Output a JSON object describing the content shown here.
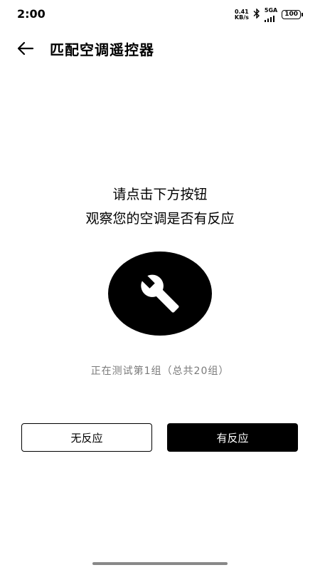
{
  "status_bar": {
    "time": "2:00",
    "net_speed_value": "0.41",
    "net_speed_unit": "KB/s",
    "bluetooth_icon": "bluetooth-icon",
    "network_type": "5GA",
    "battery": "100"
  },
  "header": {
    "back_icon": "arrow-left-icon",
    "title": "匹配空调遥控器"
  },
  "instructions": {
    "line1": "请点击下方按钮",
    "line2": "观察您的空调是否有反应"
  },
  "center_icon": "wrench-icon",
  "progress_text": "正在测试第1组（总共20组）",
  "buttons": {
    "no_response": "无反应",
    "has_response": "有反应"
  }
}
